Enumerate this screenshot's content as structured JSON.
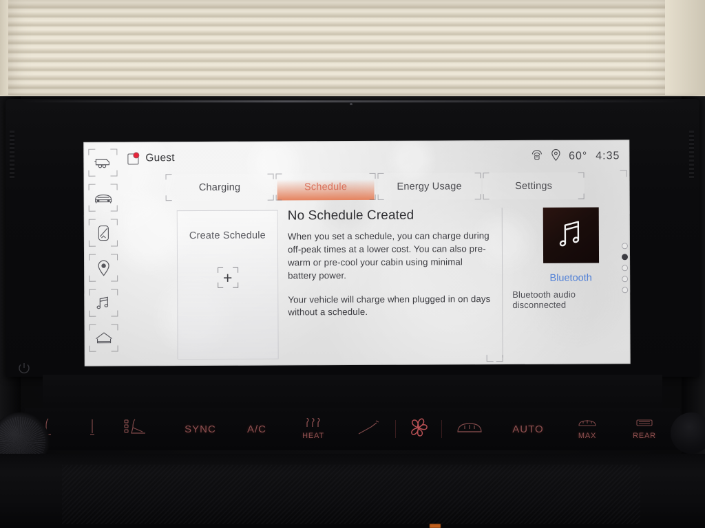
{
  "screen": {
    "header": {
      "profile_name": "Guest",
      "profile_icon": "profile-card-icon",
      "notification_dot": true,
      "status": {
        "hotspot_icon": "wifi-hotspot-icon",
        "location_icon": "location-pin-icon",
        "temperature": "60°",
        "time": "4:35"
      }
    },
    "sidebar": {
      "items": [
        {
          "icon": "trailer-icon",
          "name": "trailering"
        },
        {
          "icon": "vehicle-front-icon",
          "name": "vehicle"
        },
        {
          "icon": "device-phone-icon",
          "name": "device"
        },
        {
          "icon": "location-pin-icon",
          "name": "navigation"
        },
        {
          "icon": "music-note-icon",
          "name": "media"
        },
        {
          "icon": "home-icon",
          "name": "home"
        }
      ]
    },
    "tabs": [
      {
        "label": "Charging",
        "active": false
      },
      {
        "label": "Schedule",
        "active": true
      },
      {
        "label": "Energy Usage",
        "active": false
      },
      {
        "label": "Settings",
        "active": false
      }
    ],
    "create_card": {
      "title": "Create Schedule",
      "icon": "plus-icon"
    },
    "info": {
      "heading": "No Schedule Created",
      "paragraph1": "When you set a schedule, you can charge during off-peak times at a lower cost. You can also pre-warm or pre-cool your cabin using minimal battery power.",
      "paragraph2": "Your vehicle will charge when plugged in on days without a schedule."
    },
    "media_panel": {
      "album_art_icon": "music-note-icon",
      "source_label": "Bluetooth",
      "status_text": "Bluetooth audio disconnected"
    },
    "page_indicator": {
      "count": 5,
      "active_index": 1
    },
    "colors": {
      "accent_orange": "#e5835f",
      "accent_tab_text": "#d9705a",
      "link_blue": "#4f7fd6",
      "notification_red": "#e8253a",
      "screen_bg": "#e6e6e6",
      "climate_red": "#9b5757"
    }
  },
  "climate_bar": {
    "buttons": [
      {
        "icon": "seat-heat-left-icon",
        "label": ""
      },
      {
        "icon": "seat-vent-icon",
        "label": ""
      },
      {
        "icon": "seat-icon",
        "label": ""
      },
      {
        "label": "SYNC",
        "icon": ""
      },
      {
        "label": "A/C",
        "icon": ""
      },
      {
        "label": "HEAT",
        "icon": "heat-waves-icon"
      },
      {
        "icon": "seat-recline-icon",
        "label": ""
      },
      {
        "icon": "fan-icon",
        "label": ""
      },
      {
        "icon": "windshield-defrost-icon",
        "label": ""
      },
      {
        "label": "AUTO",
        "icon": ""
      },
      {
        "label": "MAX",
        "icon": "max-defrost-icon"
      },
      {
        "label": "REAR",
        "icon": "rear-defrost-icon"
      },
      {
        "icon": "seat-heat-right-icon",
        "label": ""
      }
    ]
  },
  "hardware": {
    "power_button_icon": "power-icon",
    "volume_knob": "volume-knob"
  }
}
